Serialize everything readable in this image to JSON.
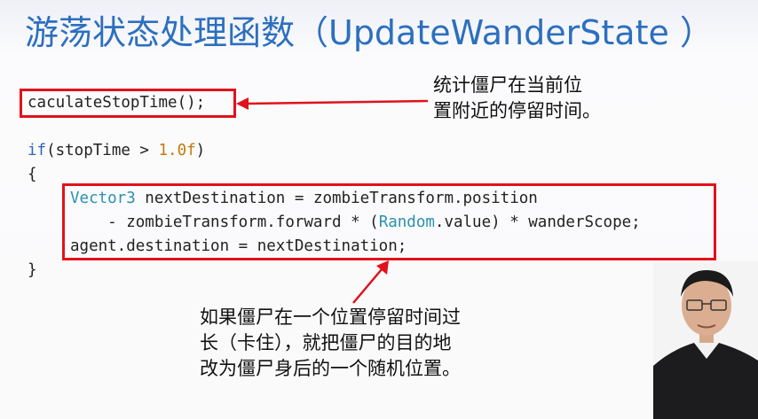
{
  "title": "游荡状态处理函数（UpdateWanderState ）",
  "code": {
    "line1": "caculateStopTime();",
    "line2_kw": "if",
    "line2_a": "(stopTime > ",
    "line2_num": "1.0f",
    "line2_b": ")",
    "line3": "{",
    "line4_type": "Vector3",
    "line4_rest": " nextDestination = zombieTransform.position",
    "line5_a": "    - zombieTransform.forward * (",
    "line5_type": "Random",
    "line5_b": ".value) * wanderScope;",
    "line6": "agent.destination = nextDestination;",
    "line7": "}"
  },
  "notes": {
    "top_line1": "统计僵尸在当前位",
    "top_line2": "置附近的停留时间。",
    "bottom_line1": "如果僵尸在一个位置停留时间过",
    "bottom_line2": "长（卡住），就把僵尸的目的地",
    "bottom_line3": "改为僵尸身后的一个随机位置。"
  },
  "colors": {
    "title": "#2c6fbf",
    "highlight_box": "#e0121b",
    "keyword": "#2d63c4",
    "type": "#2b91af",
    "number": "#c47a0a"
  },
  "icons": [
    "red-arrow-icon",
    "presenter-video"
  ]
}
